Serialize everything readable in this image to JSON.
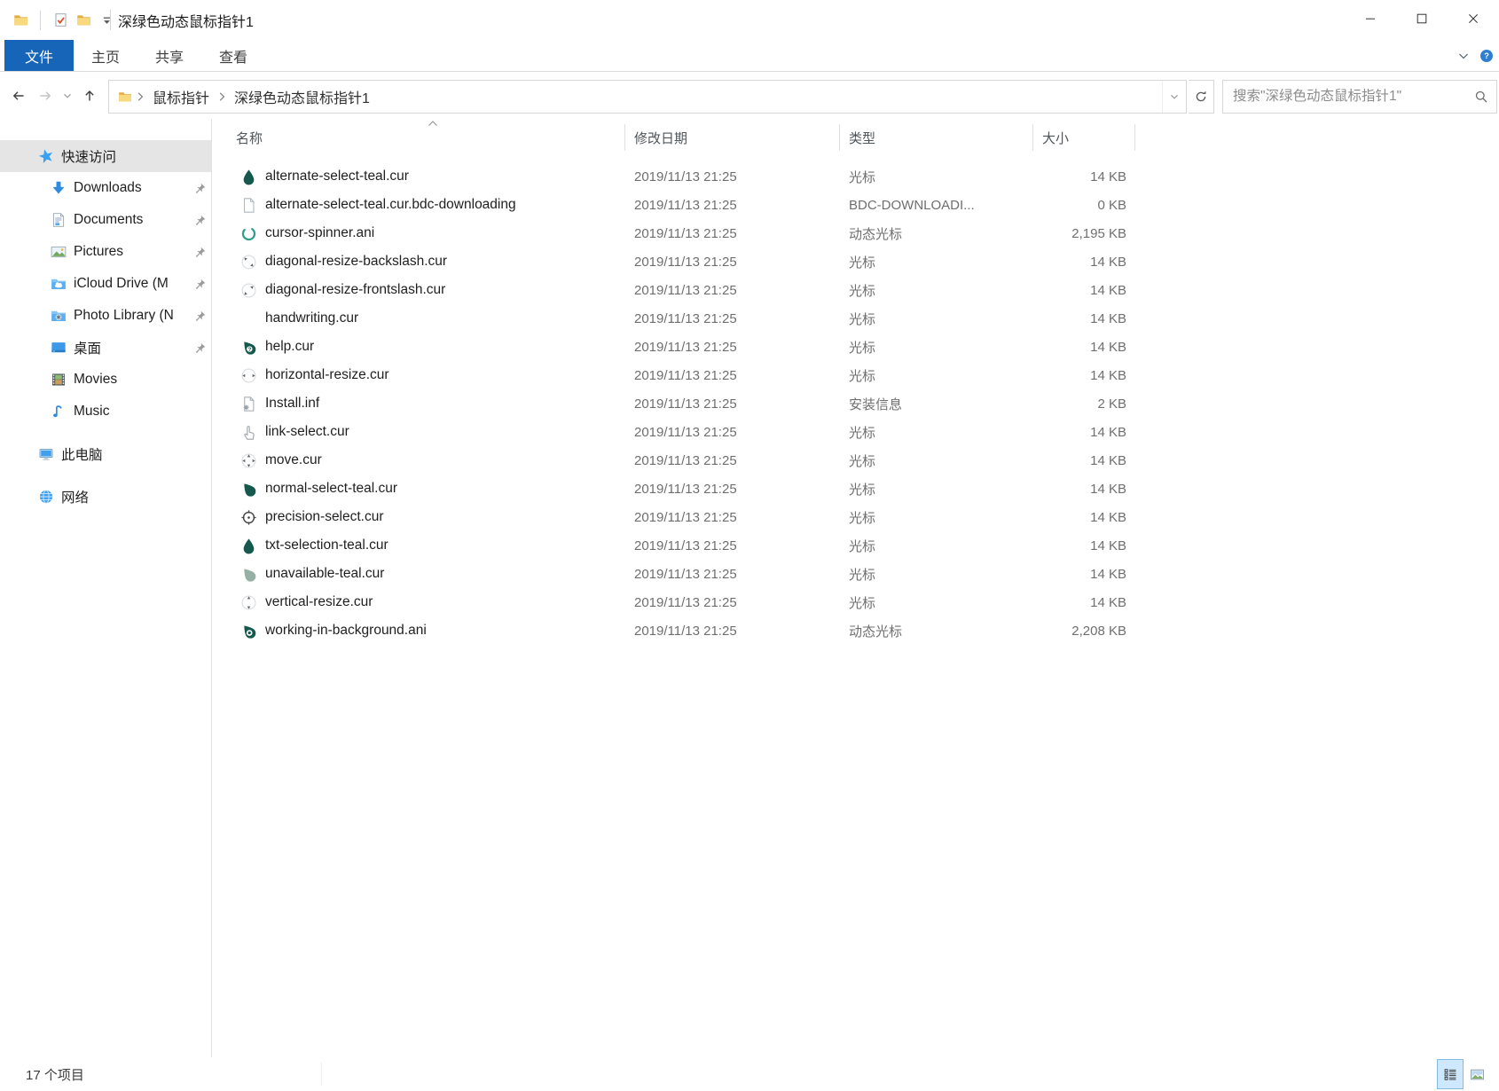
{
  "window": {
    "title": "深绿色动态鼠标指针1"
  },
  "quick_access_toolbar": {
    "icons": [
      "folder-icon",
      "check-page-icon",
      "folder-icon",
      "toolbar-dropdown-icon"
    ]
  },
  "ribbon": {
    "file_tab": "文件",
    "tabs": [
      "主页",
      "共享",
      "查看"
    ]
  },
  "address_bar": {
    "root_icon": "folder-icon",
    "breadcrumb": [
      "鼠标指针",
      "深绿色动态鼠标指针1"
    ],
    "search_placeholder": "搜索\"深绿色动态鼠标指针1\""
  },
  "sidebar": {
    "items": [
      {
        "key": "quick-access",
        "label": "快速访问",
        "icon": "quick-access-star-icon",
        "level": 0,
        "selected": true,
        "pinned": false,
        "gap": false
      },
      {
        "key": "downloads",
        "label": "Downloads",
        "icon": "downloads-icon",
        "level": 1,
        "selected": false,
        "pinned": true,
        "gap": false
      },
      {
        "key": "documents",
        "label": "Documents",
        "icon": "document-icon",
        "level": 1,
        "selected": false,
        "pinned": true,
        "gap": false
      },
      {
        "key": "pictures",
        "label": "Pictures",
        "icon": "pictures-icon",
        "level": 1,
        "selected": false,
        "pinned": true,
        "gap": false
      },
      {
        "key": "icloud-drive",
        "label": "iCloud Drive (M",
        "icon": "icloud-folder-icon",
        "level": 1,
        "selected": false,
        "pinned": true,
        "gap": false
      },
      {
        "key": "photo-library",
        "label": "Photo Library (N",
        "icon": "photo-folder-icon",
        "level": 1,
        "selected": false,
        "pinned": true,
        "gap": false
      },
      {
        "key": "desktop",
        "label": "桌面",
        "icon": "desktop-icon",
        "level": 1,
        "selected": false,
        "pinned": true,
        "gap": false
      },
      {
        "key": "movies",
        "label": "Movies",
        "icon": "movies-icon",
        "level": 1,
        "selected": false,
        "pinned": false,
        "gap": false
      },
      {
        "key": "music",
        "label": "Music",
        "icon": "music-icon",
        "level": 1,
        "selected": false,
        "pinned": false,
        "gap": false
      },
      {
        "key": "this-pc",
        "label": "此电脑",
        "icon": "this-pc-icon",
        "level": 0,
        "selected": false,
        "pinned": false,
        "gap": true
      },
      {
        "key": "network",
        "label": "网络",
        "icon": "network-icon",
        "level": 0,
        "selected": false,
        "pinned": false,
        "gap": true
      }
    ]
  },
  "file_list": {
    "columns": [
      {
        "label": "名称",
        "sorted": "asc"
      },
      {
        "label": "修改日期",
        "sorted": ""
      },
      {
        "label": "类型",
        "sorted": ""
      },
      {
        "label": "大小",
        "sorted": ""
      }
    ],
    "files": [
      {
        "name": "alternate-select-teal.cur",
        "modified": "2019/11/13 21:25",
        "type": "光标",
        "size": "14 KB",
        "icon": "teal-drop-icon"
      },
      {
        "name": "alternate-select-teal.cur.bdc-downloading",
        "modified": "2019/11/13 21:25",
        "type": "BDC-DOWNLOADI...",
        "size": "0 KB",
        "icon": "blank-page-icon"
      },
      {
        "name": "cursor-spinner.ani",
        "modified": "2019/11/13 21:25",
        "type": "动态光标",
        "size": "2,195 KB",
        "icon": "spinner-icon"
      },
      {
        "name": "diagonal-resize-backslash.cur",
        "modified": "2019/11/13 21:25",
        "type": "光标",
        "size": "14 KB",
        "icon": "diagonal-resize-backslash-icon"
      },
      {
        "name": "diagonal-resize-frontslash.cur",
        "modified": "2019/11/13 21:25",
        "type": "光标",
        "size": "14 KB",
        "icon": "diagonal-resize-frontslash-icon"
      },
      {
        "name": "handwriting.cur",
        "modified": "2019/11/13 21:25",
        "type": "光标",
        "size": "14 KB",
        "icon": "handwriting-icon"
      },
      {
        "name": "help.cur",
        "modified": "2019/11/13 21:25",
        "type": "光标",
        "size": "14 KB",
        "icon": "help-drop-icon"
      },
      {
        "name": "horizontal-resize.cur",
        "modified": "2019/11/13 21:25",
        "type": "光标",
        "size": "14 KB",
        "icon": "horizontal-resize-icon"
      },
      {
        "name": "Install.inf",
        "modified": "2019/11/13 21:25",
        "type": "安装信息",
        "size": "2 KB",
        "icon": "inf-page-icon"
      },
      {
        "name": "link-select.cur",
        "modified": "2019/11/13 21:25",
        "type": "光标",
        "size": "14 KB",
        "icon": "hand-pointer-icon"
      },
      {
        "name": "move.cur",
        "modified": "2019/11/13 21:25",
        "type": "光标",
        "size": "14 KB",
        "icon": "move-icon"
      },
      {
        "name": "normal-select-teal.cur",
        "modified": "2019/11/13 21:25",
        "type": "光标",
        "size": "14 KB",
        "icon": "teal-pointer-icon"
      },
      {
        "name": "precision-select.cur",
        "modified": "2019/11/13 21:25",
        "type": "光标",
        "size": "14 KB",
        "icon": "precision-icon"
      },
      {
        "name": "txt-selection-teal.cur",
        "modified": "2019/11/13 21:25",
        "type": "光标",
        "size": "14 KB",
        "icon": "teal-drop-icon"
      },
      {
        "name": "unavailable-teal.cur",
        "modified": "2019/11/13 21:25",
        "type": "光标",
        "size": "14 KB",
        "icon": "gray-drop-icon"
      },
      {
        "name": "vertical-resize.cur",
        "modified": "2019/11/13 21:25",
        "type": "光标",
        "size": "14 KB",
        "icon": "vertical-resize-icon"
      },
      {
        "name": "working-in-background.ani",
        "modified": "2019/11/13 21:25",
        "type": "动态光标",
        "size": "2,208 KB",
        "icon": "teal-ring-drop-icon"
      }
    ]
  },
  "status_bar": {
    "items_count": "17 个项目",
    "views": [
      {
        "name": "details-view",
        "selected": true
      },
      {
        "name": "large-icons-view",
        "selected": false
      }
    ]
  },
  "colors": {
    "file_tab_blue": "#1665b8",
    "cursor_teal": "#15584e",
    "cursor_teal_muted": "#96b0a6",
    "selection_gray": "#e5e5e5"
  }
}
